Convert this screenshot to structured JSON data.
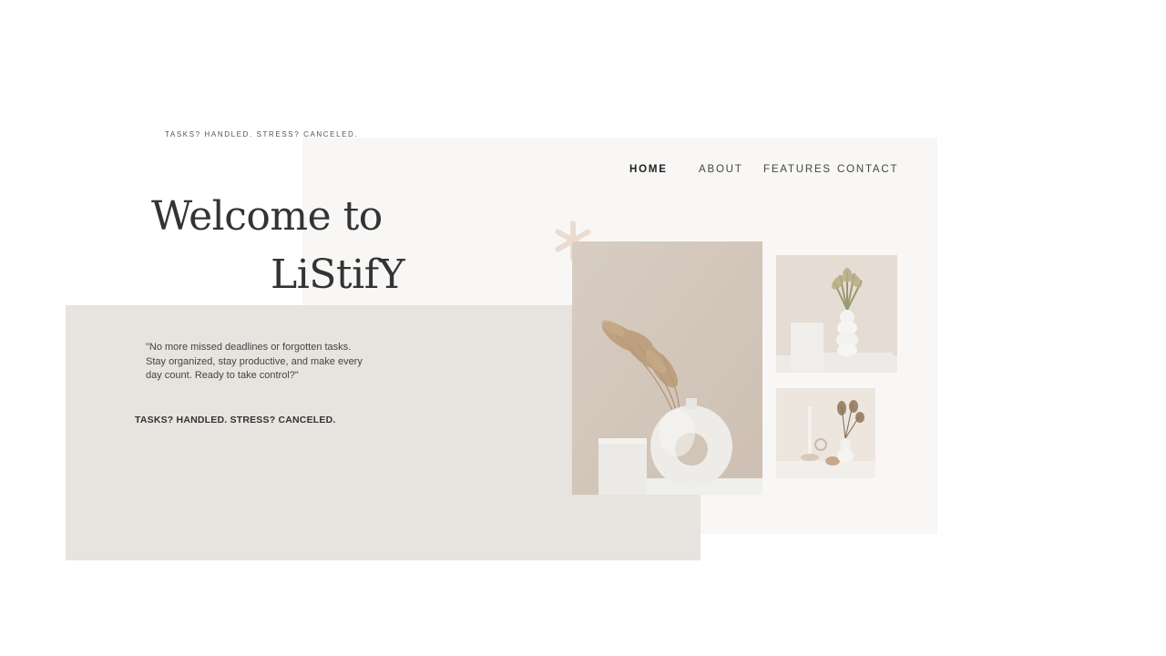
{
  "tagline_small": "TASKS? HANDLED. STRESS? CANCELED.",
  "nav": {
    "items": [
      {
        "label": "HOME",
        "active": true
      },
      {
        "label": "ABOUT",
        "active": false
      },
      {
        "label": "FEATURES",
        "active": false
      },
      {
        "label": "CONTACT",
        "active": false
      }
    ]
  },
  "hero": {
    "title_line1": "Welcome to",
    "title_line2": "LiStifY",
    "quote": "\"No more missed deadlines or forgotten tasks. Stay organized, stay productive, and make every day count. Ready to take control?\"",
    "tagline": "TASKS? HANDLED. STRESS? CANCELED."
  },
  "images": {
    "main": "ring-vase-with-dried-pampas-photo",
    "top": "white-stacked-vase-with-palm-leaves-photo",
    "bottom": "candle-holder-and-vase-with-dried-flowers-photo"
  },
  "colors": {
    "panel_light": "#f8f7f5",
    "panel_beige": "#e7e3de",
    "asterisk": "#ebdcd2",
    "text_dark": "#333333"
  }
}
